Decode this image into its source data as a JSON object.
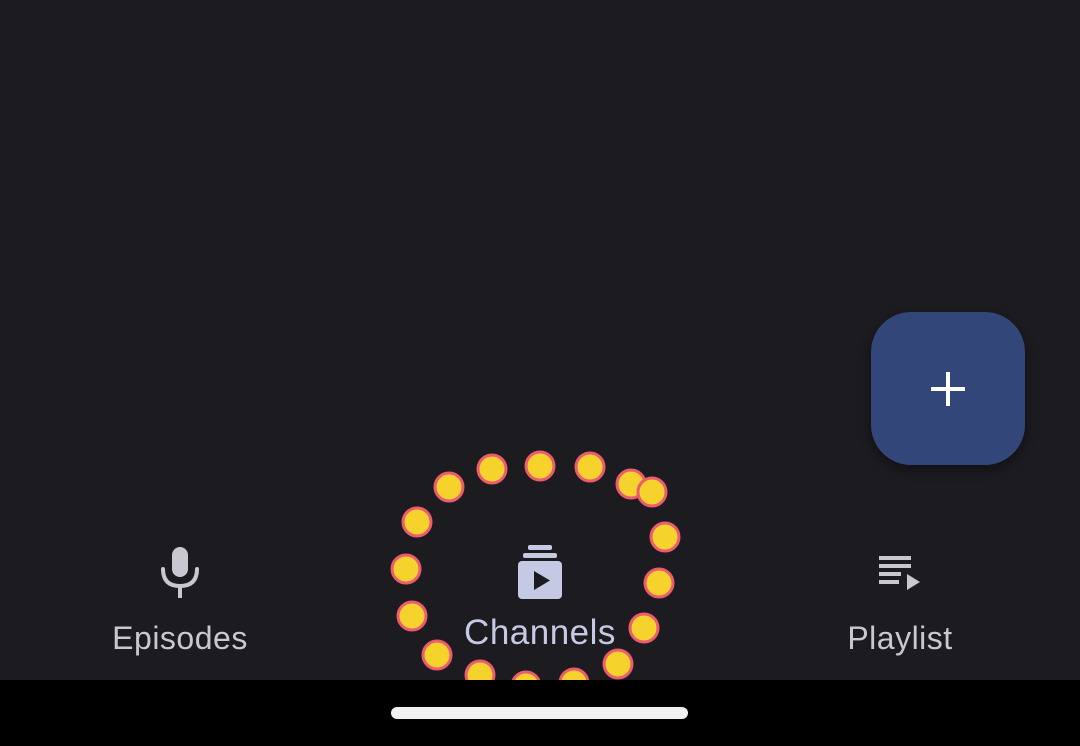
{
  "fab": {
    "icon": "plus-icon"
  },
  "nav": {
    "items": [
      {
        "label": "Episodes",
        "icon": "microphone-icon",
        "active": false
      },
      {
        "label": "Channels",
        "icon": "subscriptions-icon",
        "active": true
      },
      {
        "label": "Playlist",
        "icon": "playlist-play-icon",
        "active": false
      }
    ]
  },
  "colors": {
    "background": "#1c1b1f",
    "fab": "#324679",
    "active_label": "#c6c9e4",
    "inactive_label": "#c9c7cf",
    "touch_dot_fill": "#f6d22c",
    "touch_dot_stroke": "#ec5b6f"
  }
}
